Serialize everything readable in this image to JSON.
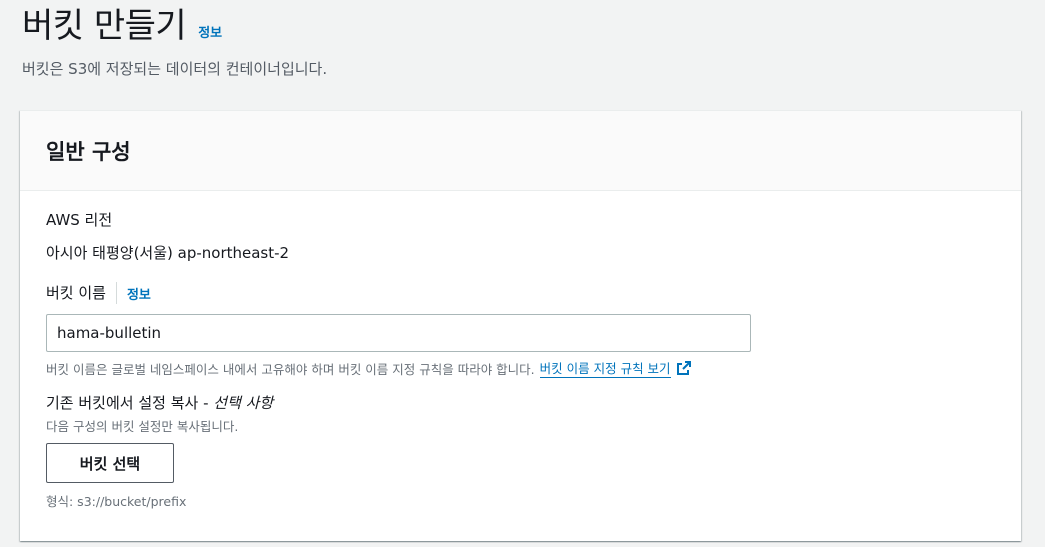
{
  "header": {
    "title": "버킷 만들기",
    "info_link": "정보",
    "description": "버킷은 S3에 저장되는 데이터의 컨테이너입니다."
  },
  "panel": {
    "title": "일반 구성",
    "region": {
      "label": "AWS 리전",
      "value": "아시아 태평양(서울) ap-northeast-2"
    },
    "bucket_name": {
      "label": "버킷 이름",
      "info_link": "정보",
      "value": "hama-bulletin",
      "constraint": "버킷 이름은 글로벌 네임스페이스 내에서 고유해야 하며 버킷 이름 지정 규칙을 따라야 합니다.",
      "rules_link": "버킷 이름 지정 규칙 보기"
    },
    "copy_settings": {
      "label": "기존 버킷에서 설정 복사 - ",
      "optional": "선택 사항",
      "description": "다음 구성의 버킷 설정만 복사됩니다.",
      "button": "버킷 선택",
      "format_hint": "형식: s3://bucket/prefix"
    }
  },
  "colors": {
    "link": "#0073bb",
    "background": "#f2f3f3",
    "panel_header": "#fafafa"
  },
  "icons": {
    "external_link": "external-link-icon"
  }
}
